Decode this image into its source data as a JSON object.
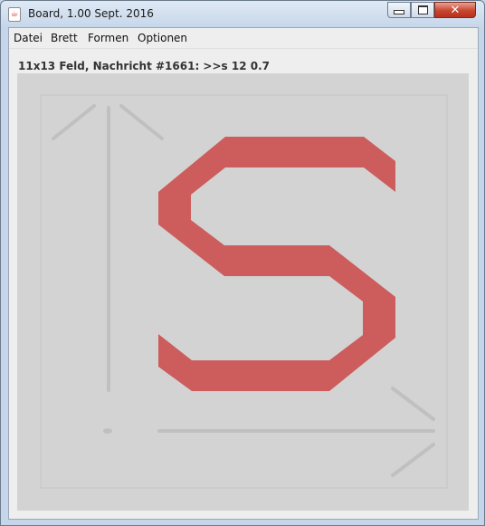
{
  "window": {
    "title": "Board, 1.00 Sept. 2016",
    "app_icon": "java-icon",
    "close_glyph": "✕"
  },
  "menubar": {
    "items": [
      "Datei",
      "Brett",
      "Formen",
      "Optionen"
    ]
  },
  "status": {
    "text": "11x13 Feld, Nachricht #1661: >>s 12 0.7"
  },
  "board": {
    "glyph": "S",
    "glyph_color": "#cd5c5c",
    "line_color": "#c0c0c0",
    "background": "#d3d3d3"
  }
}
